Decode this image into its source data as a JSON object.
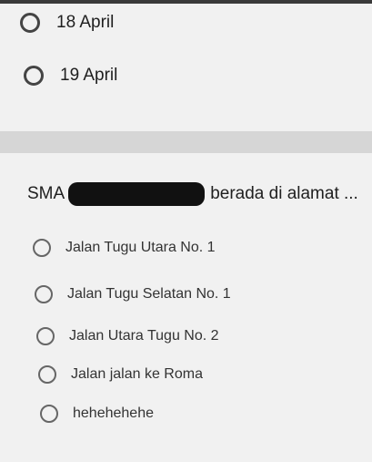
{
  "question1": {
    "options": [
      "18 April",
      "19 April"
    ]
  },
  "question2": {
    "prefix": "SMA",
    "suffix": "berada di alamat ...",
    "options": [
      "Jalan Tugu Utara No. 1",
      "Jalan Tugu Selatan No. 1",
      "Jalan Utara Tugu No. 2",
      "Jalan jalan ke Roma",
      "hehehehehe"
    ]
  }
}
